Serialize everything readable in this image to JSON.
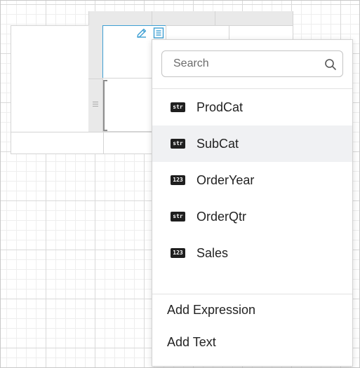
{
  "search": {
    "placeholder": "Search"
  },
  "fields": [
    {
      "type": "str",
      "name": "ProdCat",
      "hovered": false
    },
    {
      "type": "str",
      "name": "SubCat",
      "hovered": true
    },
    {
      "type": "123",
      "name": "OrderYear",
      "hovered": false
    },
    {
      "type": "str",
      "name": "OrderQtr",
      "hovered": false
    },
    {
      "type": "123",
      "name": "Sales",
      "hovered": false
    }
  ],
  "actions": {
    "add_expression": "Add Expression",
    "add_text": "Add Text"
  },
  "colors": {
    "selection": "#3d9fd3",
    "hover_row": "#f0f1f3",
    "badge": "#1f1f1f"
  },
  "icons": {
    "cell_edit": "pencil-icon",
    "cell_properties": "properties-icon",
    "search": "search-icon"
  }
}
